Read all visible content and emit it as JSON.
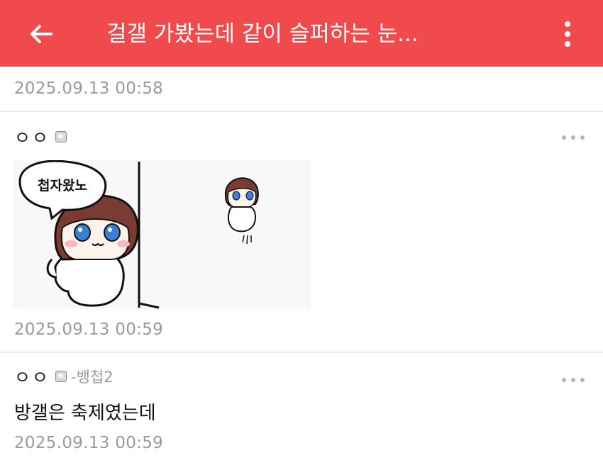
{
  "appbar": {
    "title": "걸갤 가봤는데 같이 슬퍼하는 눈...",
    "back_icon": "arrow-left-icon",
    "menu_icon": "more-vertical-icon",
    "color": "#f04a4c"
  },
  "post": {
    "timestamp": "2025.09.13 00:58"
  },
  "comments": [
    {
      "author": "ㅇㅇ",
      "badge_icon": "fixed-nick-badge-icon",
      "sticker": {
        "speech_text": "첩자왔노"
      },
      "timestamp": "2025.09.13 00:59",
      "more_icon": "more-horizontal-icon"
    },
    {
      "author": "ㅇㅇ",
      "badge_icon": "fixed-nick-badge-icon",
      "reply_to": "-뱅첩2",
      "text": "방갤은 축제였는데",
      "timestamp": "2025.09.13 00:59",
      "more_icon": "more-horizontal-icon"
    }
  ]
}
